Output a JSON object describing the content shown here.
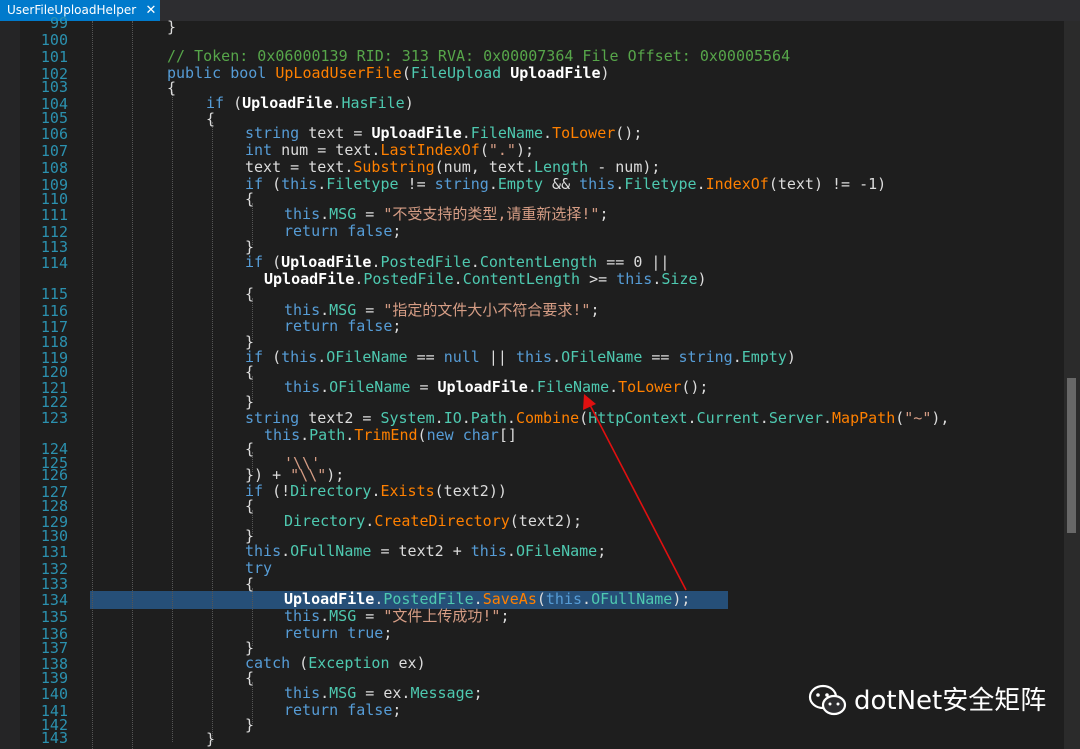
{
  "tab": {
    "title": "UserFileUploadHelper",
    "close_glyph": "✕"
  },
  "lines": [
    {
      "n": "99",
      "t": 23
    },
    {
      "n": "100",
      "t": 40
    },
    {
      "n": "101",
      "t": 57
    },
    {
      "n": "102",
      "t": 74
    },
    {
      "n": "103",
      "t": 87
    },
    {
      "n": "104",
      "t": 104
    },
    {
      "n": "105",
      "t": 118
    },
    {
      "n": "106",
      "t": 134
    },
    {
      "n": "107",
      "t": 151
    },
    {
      "n": "108",
      "t": 168
    },
    {
      "n": "109",
      "t": 185
    },
    {
      "n": "110",
      "t": 199
    },
    {
      "n": "111",
      "t": 215
    },
    {
      "n": "112",
      "t": 232
    },
    {
      "n": "113",
      "t": 247
    },
    {
      "n": "114",
      "t": 263
    },
    {
      "n": "115",
      "t": 294
    },
    {
      "n": "116",
      "t": 311
    },
    {
      "n": "117",
      "t": 327
    },
    {
      "n": "118",
      "t": 342
    },
    {
      "n": "119",
      "t": 358
    },
    {
      "n": "120",
      "t": 372
    },
    {
      "n": "121",
      "t": 388
    },
    {
      "n": "122",
      "t": 402
    },
    {
      "n": "123",
      "t": 418
    },
    {
      "n": "124",
      "t": 449
    },
    {
      "n": "125",
      "t": 463
    },
    {
      "n": "126",
      "t": 475
    },
    {
      "n": "127",
      "t": 492
    },
    {
      "n": "128",
      "t": 506
    },
    {
      "n": "129",
      "t": 522
    },
    {
      "n": "130",
      "t": 536
    },
    {
      "n": "131",
      "t": 552
    },
    {
      "n": "132",
      "t": 569
    },
    {
      "n": "133",
      "t": 584
    },
    {
      "n": "134",
      "t": 600
    },
    {
      "n": "135",
      "t": 617
    },
    {
      "n": "136",
      "t": 634
    },
    {
      "n": "137",
      "t": 648
    },
    {
      "n": "138",
      "t": 664
    },
    {
      "n": "139",
      "t": 678
    },
    {
      "n": "140",
      "t": 694
    },
    {
      "n": "141",
      "t": 711
    },
    {
      "n": "142",
      "t": 725
    },
    {
      "n": "143",
      "t": 738
    }
  ],
  "code": {
    "l99": "}",
    "l101": "// Token: 0x06000139 RID: 313 RVA: 0x00007364 File Offset: 0x00005564",
    "l102a": "public bool ",
    "l102b": "UpLoadUserFile",
    "l102c": "(",
    "l102d": "FileUpload",
    "l102e": " ",
    "l102f": "UploadFile",
    "l102g": ")",
    "l103": "{",
    "l104a": "if",
    "l104b": " (",
    "l104c": "UploadFile",
    "l104d": ".",
    "l104e": "HasFile",
    "l104f": ")",
    "l105": "{",
    "l106a": "string",
    "l106b": " text = ",
    "l106c": "UploadFile",
    "l106d": ".",
    "l106e": "FileName",
    "l106f": ".",
    "l106g": "ToLower",
    "l106h": "();",
    "l107a": "int",
    "l107b": " num = text.",
    "l107c": "LastIndexOf",
    "l107d": "(",
    "l107e": "\".\"",
    "l107f": ");",
    "l108a": "text = text.",
    "l108b": "Substring",
    "l108c": "(num, text.",
    "l108d": "Length",
    "l108e": " - num);",
    "l109a": "if",
    "l109b": " (",
    "l109c": "this",
    "l109d": ".",
    "l109e": "Filetype",
    "l109f": " != ",
    "l109g": "string",
    "l109h": ".",
    "l109i": "Empty",
    "l109j": " && ",
    "l109k": "this",
    "l109l": ".",
    "l109m": "Filetype",
    "l109n": ".",
    "l109o": "IndexOf",
    "l109p": "(text) != -1)",
    "l110": "{",
    "l111a": "this",
    "l111b": ".",
    "l111c": "MSG",
    "l111d": " = ",
    "l111e": "\"不受支持的类型,请重新选择!\"",
    "l111f": ";",
    "l112a": "return",
    "l112b": " ",
    "l112c": "false",
    "l112d": ";",
    "l113": "}",
    "l114a": "if",
    "l114b": " (",
    "l114c": "UploadFile",
    "l114d": ".",
    "l114e": "PostedFile",
    "l114f": ".",
    "l114g": "ContentLength",
    "l114h": " == 0 ||",
    "l114wa": "UploadFile",
    "l114wb": ".",
    "l114wc": "PostedFile",
    "l114wd": ".",
    "l114we": "ContentLength",
    "l114wf": " >= ",
    "l114wg": "this",
    "l114wh": ".",
    "l114wi": "Size",
    "l114wj": ")",
    "l115": "{",
    "l116a": "this",
    "l116b": ".",
    "l116c": "MSG",
    "l116d": " = ",
    "l116e": "\"指定的文件大小不符合要求!\"",
    "l116f": ";",
    "l117a": "return",
    "l117b": " ",
    "l117c": "false",
    "l117d": ";",
    "l118": "}",
    "l119a": "if",
    "l119b": " (",
    "l119c": "this",
    "l119d": ".",
    "l119e": "OFileName",
    "l119f": " == ",
    "l119g": "null",
    "l119h": " || ",
    "l119i": "this",
    "l119j": ".",
    "l119k": "OFileName",
    "l119l": " == ",
    "l119m": "string",
    "l119n": ".",
    "l119o": "Empty",
    "l119p": ")",
    "l120": "{",
    "l121a": "this",
    "l121b": ".",
    "l121c": "OFileName",
    "l121d": " = ",
    "l121e": "UploadFile",
    "l121f": ".",
    "l121g": "FileName",
    "l121h": ".",
    "l121i": "ToLower",
    "l121j": "();",
    "l122": "}",
    "l123a": "string",
    "l123b": " text2 = ",
    "l123c": "System",
    "l123d": ".",
    "l123e": "IO",
    "l123f": ".",
    "l123g": "Path",
    "l123h": ".",
    "l123i": "Combine",
    "l123j": "(",
    "l123k": "HttpContext",
    "l123l": ".",
    "l123m": "Current",
    "l123n": ".",
    "l123o": "Server",
    "l123p": ".",
    "l123q": "MapPath",
    "l123r": "(",
    "l123s": "\"~\"",
    "l123t": "),",
    "l123wa": "this",
    "l123wb": ".",
    "l123wc": "Path",
    "l123wd": ".",
    "l123we": "TrimEnd",
    "l123wf": "(",
    "l123wg": "new",
    "l123wh": " ",
    "l123wi": "char",
    "l123wj": "[]",
    "l124": "{",
    "l125": "'\\\\'",
    "l126a": "}) + ",
    "l126b": "\"\\\\\"",
    "l126c": ");",
    "l127a": "if",
    "l127b": " (!",
    "l127c": "Directory",
    "l127d": ".",
    "l127e": "Exists",
    "l127f": "(text2))",
    "l128": "{",
    "l129a": "Directory",
    "l129b": ".",
    "l129c": "CreateDirectory",
    "l129d": "(text2);",
    "l130": "}",
    "l131a": "this",
    "l131b": ".",
    "l131c": "OFullName",
    "l131d": " = text2 + ",
    "l131e": "this",
    "l131f": ".",
    "l131g": "OFileName",
    "l131h": ";",
    "l132": "try",
    "l133": "{",
    "l134a": "UploadFile",
    "l134b": ".",
    "l134c": "PostedFile",
    "l134d": ".",
    "l134e": "SaveAs",
    "l134f": "(",
    "l134g": "this",
    "l134h": ".",
    "l134i": "OFullName",
    "l134j": ");",
    "l135a": "this",
    "l135b": ".",
    "l135c": "MSG",
    "l135d": " = ",
    "l135e": "\"文件上传成功!\"",
    "l135f": ";",
    "l136a": "return",
    "l136b": " ",
    "l136c": "true",
    "l136d": ";",
    "l137": "}",
    "l138a": "catch",
    "l138b": " (",
    "l138c": "Exception",
    "l138d": " ex)",
    "l139": "{",
    "l140a": "this",
    "l140b": ".",
    "l140c": "MSG",
    "l140d": " = ex.",
    "l140e": "Message",
    "l140f": ";",
    "l141a": "return",
    "l141b": " ",
    "l141c": "false",
    "l141d": ";",
    "l142": "}",
    "l143": "}"
  },
  "watermark": {
    "text": "dotNet安全矩阵",
    "icon": "wechat-icon"
  },
  "colors": {
    "tab_active": "#007acc",
    "selection": "#264f78",
    "arrow": "#e01010",
    "keyword": "#569cd6",
    "comment": "#57a64a",
    "string": "#d69d85",
    "method": "#ff8000",
    "property": "#4ec9b0",
    "line_number": "#2b91af"
  }
}
